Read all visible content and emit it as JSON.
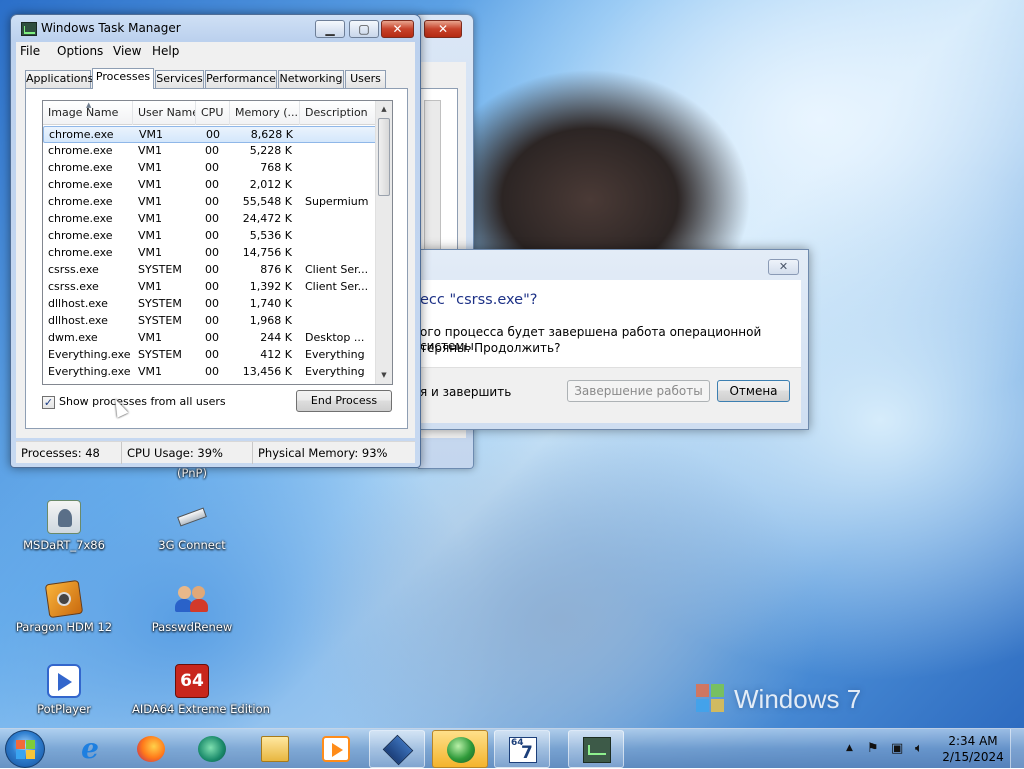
{
  "desktop": {
    "os_logo_text": "Windows 7",
    "icons": [
      {
        "label": "(PnP)",
        "icon": "pnp-driver-icon"
      },
      {
        "label": "MSDaRT_7x86",
        "icon": "msdart-icon"
      },
      {
        "label": "3G Connect",
        "icon": "usb-modem-icon"
      },
      {
        "label": "Paragon HDM 12",
        "icon": "paragon-disk-icon"
      },
      {
        "label": "PasswdRenew",
        "icon": "users-icon"
      },
      {
        "label": "PotPlayer",
        "icon": "potplayer-icon"
      },
      {
        "label": "AIDA64 Extreme Edition",
        "icon": "aida64-icon",
        "badge": "64"
      }
    ]
  },
  "task_manager": {
    "title": "Windows Task Manager",
    "menu": [
      "File",
      "Options",
      "View",
      "Help"
    ],
    "tabs": [
      "Applications",
      "Processes",
      "Services",
      "Performance",
      "Networking",
      "Users"
    ],
    "active_tab": "Processes",
    "columns": [
      "Image Name",
      "User Name",
      "CPU",
      "Memory (...",
      "Description"
    ],
    "rows": [
      {
        "name": "chrome.exe",
        "user": "VM1",
        "cpu": "00",
        "mem": "8,628 K",
        "desc": "",
        "selected": true
      },
      {
        "name": "chrome.exe",
        "user": "VM1",
        "cpu": "00",
        "mem": "5,228 K",
        "desc": ""
      },
      {
        "name": "chrome.exe",
        "user": "VM1",
        "cpu": "00",
        "mem": "768 K",
        "desc": ""
      },
      {
        "name": "chrome.exe",
        "user": "VM1",
        "cpu": "00",
        "mem": "2,012 K",
        "desc": ""
      },
      {
        "name": "chrome.exe",
        "user": "VM1",
        "cpu": "00",
        "mem": "55,548 K",
        "desc": "Supermium"
      },
      {
        "name": "chrome.exe",
        "user": "VM1",
        "cpu": "00",
        "mem": "24,472 K",
        "desc": ""
      },
      {
        "name": "chrome.exe",
        "user": "VM1",
        "cpu": "00",
        "mem": "5,536 K",
        "desc": ""
      },
      {
        "name": "chrome.exe",
        "user": "VM1",
        "cpu": "00",
        "mem": "14,756 K",
        "desc": ""
      },
      {
        "name": "csrss.exe",
        "user": "SYSTEM",
        "cpu": "00",
        "mem": "876 K",
        "desc": "Client Ser..."
      },
      {
        "name": "csrss.exe",
        "user": "VM1",
        "cpu": "00",
        "mem": "1,392 K",
        "desc": "Client Ser..."
      },
      {
        "name": "dllhost.exe",
        "user": "SYSTEM",
        "cpu": "00",
        "mem": "1,740 K",
        "desc": ""
      },
      {
        "name": "dllhost.exe",
        "user": "SYSTEM",
        "cpu": "00",
        "mem": "1,968 K",
        "desc": ""
      },
      {
        "name": "dwm.exe",
        "user": "VM1",
        "cpu": "00",
        "mem": "244 K",
        "desc": "Desktop ..."
      },
      {
        "name": "Everything.exe",
        "user": "SYSTEM",
        "cpu": "00",
        "mem": "412 K",
        "desc": "Everything"
      },
      {
        "name": "Everything.exe",
        "user": "VM1",
        "cpu": "00",
        "mem": "13,456 K",
        "desc": "Everything"
      }
    ],
    "show_all_users_label": "Show processes from all users",
    "show_all_users_checked": true,
    "end_process_label": "End Process",
    "status": {
      "processes": "Processes: 48",
      "cpu": "CPU Usage: 39%",
      "memory": "Physical Memory: 93%"
    }
  },
  "dialog": {
    "question": "есс \"csrss.exe\"?",
    "message_line1": "ого процесса будет завершена работа операционной системы.",
    "message_line2": "теряны.  Продолжить?",
    "checkbox_label": "я и завершить",
    "shutdown_button": "Завершение работы",
    "cancel_button": "Отмена"
  },
  "taskbar": {
    "apps": [
      {
        "name": "internet-explorer-icon"
      },
      {
        "name": "firefox-icon"
      },
      {
        "name": "chat-app-icon"
      },
      {
        "name": "file-explorer-icon"
      },
      {
        "name": "media-player-icon"
      },
      {
        "name": "virtualbox-icon"
      },
      {
        "name": "download-manager-icon"
      },
      {
        "name": "cpu-z-64-icon",
        "badge": "64",
        "sub": "7"
      },
      {
        "name": "task-manager-icon"
      }
    ],
    "clock": {
      "time": "2:34 AM",
      "date": "2/15/2024"
    }
  }
}
